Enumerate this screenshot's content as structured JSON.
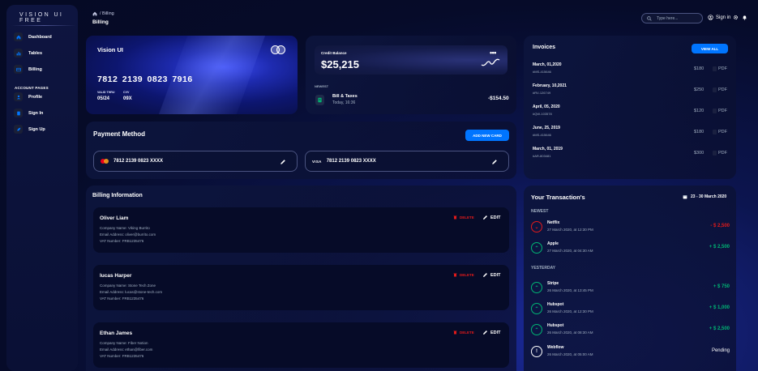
{
  "brand": "VISION UI FREE",
  "colors": {
    "accent": "#0075ff",
    "danger": "#e31a1a",
    "success": "#01b574",
    "muted": "#a0aec0"
  },
  "sidebar": {
    "items": [
      {
        "label": "Dashboard",
        "icon": "home-icon"
      },
      {
        "label": "Tables",
        "icon": "chart-icon"
      },
      {
        "label": "Billing",
        "icon": "credit-card-icon"
      }
    ],
    "section_label": "ACCOUNT PAGES",
    "account_items": [
      {
        "label": "Profile",
        "icon": "person-icon"
      },
      {
        "label": "Sign In",
        "icon": "document-icon"
      },
      {
        "label": "Sign Up",
        "icon": "rocket-icon"
      }
    ]
  },
  "header": {
    "breadcrumb_current": "/ Billing",
    "title": "Billing",
    "search_placeholder": "Type here...",
    "signin_label": "Sign in"
  },
  "credit_card": {
    "title": "Vision UI",
    "number": "7812 2139 0823 7916",
    "valid_label": "VALID THRU",
    "valid_value": "05/24",
    "cvv_label": "CVV",
    "cvv_value": "09X"
  },
  "balance": {
    "label": "Credit Balance",
    "value": "$25,215",
    "newest_label": "NEWEST",
    "bill_name": "Bill & Taxes",
    "bill_date": "Today, 16:36",
    "bill_amount": "-$154.50"
  },
  "payment_method": {
    "title": "Payment Method",
    "add_label": "ADD NEW CARD",
    "cards": [
      {
        "brand": "mastercard",
        "number": "7812 2139 0823 XXXX"
      },
      {
        "brand": "VISA",
        "number": "7812 2139 0823 XXXX"
      }
    ]
  },
  "invoices": {
    "title": "Invoices",
    "view_all_label": "VIEW ALL",
    "items": [
      {
        "date": "March, 01,2020",
        "id": "#MS-415646",
        "amount": "$180",
        "pdf": "PDF"
      },
      {
        "date": "February, 10,2021",
        "id": "#RV-126749",
        "amount": "$250",
        "pdf": "PDF"
      },
      {
        "date": "April, 05, 2020",
        "id": "#QW-103578",
        "amount": "$120",
        "pdf": "PDF"
      },
      {
        "date": "June, 25, 2019",
        "id": "#MS-415646",
        "amount": "$180",
        "pdf": "PDF"
      },
      {
        "date": "March, 01, 2019",
        "id": "#AR-803481",
        "amount": "$300",
        "pdf": "PDF"
      }
    ]
  },
  "billing_info": {
    "title": "Billing Information",
    "delete_label": "DELETE",
    "edit_label": "EDIT",
    "items": [
      {
        "name": "Oliver Liam",
        "company": "Company Name: Viking Burrito",
        "email": "Email Address: oliver@burrito.com",
        "vat": "VAT Number: FRB1235476"
      },
      {
        "name": "lucas Harper",
        "company": "Company Name: Stone Tech Zone",
        "email": "Email Address: lucas@stone-tech.com",
        "vat": "VAT Number: FRB1235476"
      },
      {
        "name": "Ethan James",
        "company": "Company Name: Fiber Notion",
        "email": "Email Address: ethan@fiber.com",
        "vat": "VAT Number: FRB1235476"
      }
    ]
  },
  "transactions": {
    "title": "Your Transaction's",
    "range": "23 - 30 March 2020",
    "newest_label": "NEWEST",
    "yesterday_label": "YESTERDAY",
    "newest": [
      {
        "name": "Netflix",
        "date": "27 March 2020, at 12:30 PM",
        "amount": "- $ 2,500",
        "kind": "out"
      },
      {
        "name": "Apple",
        "date": "27 March 2020, at 04:30 AM",
        "amount": "+ $ 2,500",
        "kind": "in"
      }
    ],
    "yesterday": [
      {
        "name": "Stripe",
        "date": "26 March 2020, at 13:45 PM",
        "amount": "+ $ 750",
        "kind": "in"
      },
      {
        "name": "Hubspot",
        "date": "26 March 2020, at 12:30 PM",
        "amount": "+ $ 1,000",
        "kind": "in"
      },
      {
        "name": "Hubspot",
        "date": "26 March 2020, at 08:30 AM",
        "amount": "+ $ 2,500",
        "kind": "in"
      },
      {
        "name": "Webflow",
        "date": "26 March 2020, at 05:00 AM",
        "amount": "Pending",
        "kind": "pending"
      }
    ]
  }
}
